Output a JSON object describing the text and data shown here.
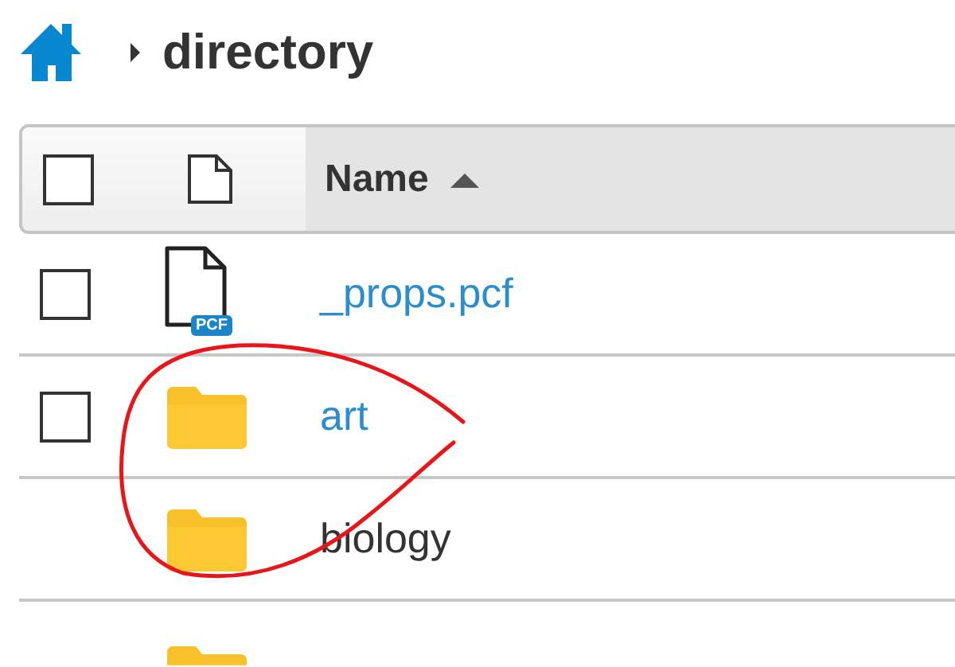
{
  "breadcrumb": {
    "current": "directory"
  },
  "table": {
    "columns": [
      {
        "label": "Name",
        "sort_ascending": true
      }
    ],
    "header_checkbox": {
      "checked": false
    },
    "rows": [
      {
        "kind": "file",
        "badge": "PCF",
        "name": "_props.pcf",
        "link": true,
        "checkbox": true,
        "checked": false
      },
      {
        "kind": "folder",
        "name": "art",
        "link": true,
        "checkbox": true,
        "checked": false
      },
      {
        "kind": "folder",
        "name": "biology",
        "link": false,
        "checkbox": false
      },
      {
        "kind": "folder",
        "checkbox": false
      }
    ]
  },
  "annotation": {
    "kind": "circle"
  }
}
